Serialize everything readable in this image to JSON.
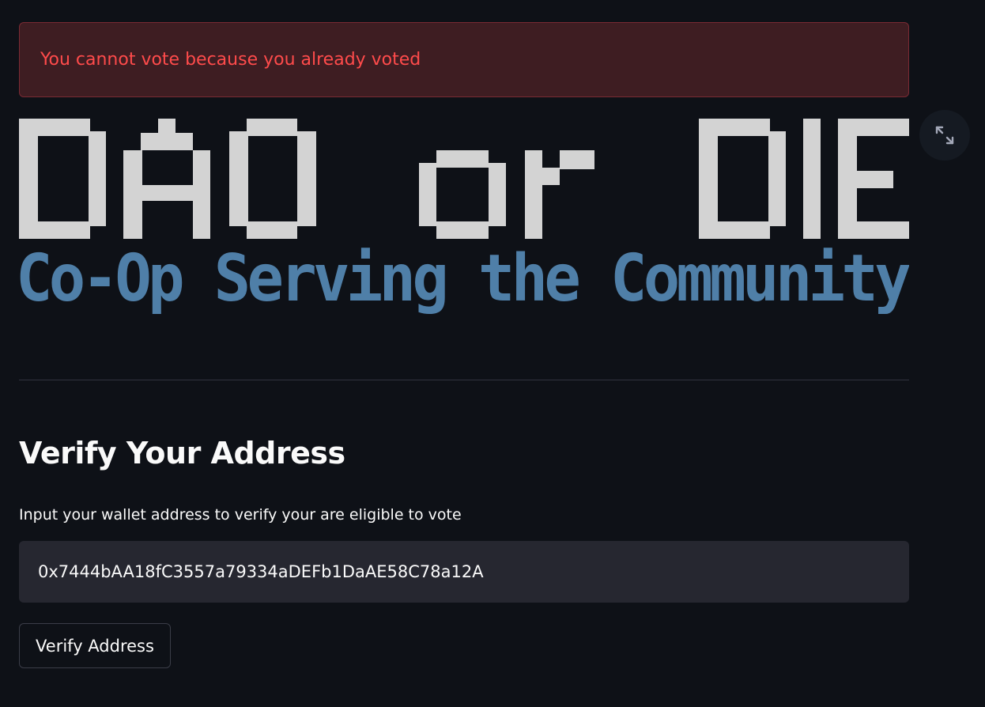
{
  "alert": {
    "message": "You cannot vote because you already voted",
    "color": "#ff4b4b"
  },
  "banner": {
    "title": "DAO or DIE",
    "subtitle": "Co-Op Serving the Community",
    "title_color": "#d3d3d3",
    "subtitle_color": "#4f7fa8"
  },
  "expand_button": {
    "icon": "expand-icon"
  },
  "verify_section": {
    "title": "Verify Your Address",
    "input_label": "Input your wallet address to verify your are eligible to vote",
    "address_value": "0x7444bAA18fC3557a79334aDEFb1DaAE58C78a12A",
    "button_label": "Verify Address"
  }
}
